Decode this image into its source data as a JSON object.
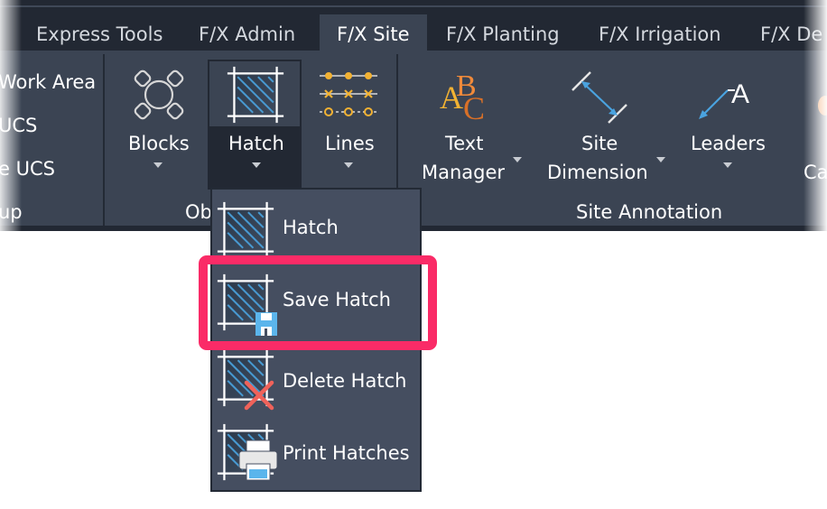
{
  "tabs": [
    {
      "label": "Express Tools",
      "active": false
    },
    {
      "label": "F/X Admin",
      "active": false
    },
    {
      "label": "F/X Site",
      "active": true
    },
    {
      "label": "F/X Planting",
      "active": false
    },
    {
      "label": "F/X Irrigation",
      "active": false
    },
    {
      "label": "F/X De",
      "active": false
    }
  ],
  "left_panel": {
    "items": [
      "Work Area",
      "UCS",
      "e UCS"
    ],
    "group_label": "up"
  },
  "objects_panel": {
    "buttons": [
      {
        "label": "Blocks",
        "icon": "blocks-icon"
      },
      {
        "label": "Hatch",
        "icon": "hatch-icon"
      },
      {
        "label": "Lines",
        "icon": "lines-icon"
      }
    ],
    "group_label": "Ob"
  },
  "site_annotation_panel": {
    "buttons": [
      {
        "label_line1": "Text",
        "label_line2": "Manager",
        "icon": "text-manager-icon"
      },
      {
        "label_line1": "Site",
        "label_line2": "Dimension",
        "icon": "site-dimension-icon"
      },
      {
        "label_line1": "Leaders",
        "label_line2": "",
        "icon": "leaders-icon"
      },
      {
        "label_line1": "",
        "label_line2": "Ca",
        "icon": "callout-icon"
      }
    ],
    "group_label": "Site Annotation"
  },
  "hatch_menu": {
    "items": [
      {
        "label": "Hatch",
        "icon": "hatch-icon",
        "highlighted": false
      },
      {
        "label": "Save Hatch",
        "icon": "save-hatch-icon",
        "highlighted": true
      },
      {
        "label": "Delete Hatch",
        "icon": "delete-hatch-icon",
        "highlighted": false
      },
      {
        "label": "Print Hatches",
        "icon": "print-hatches-icon",
        "highlighted": false
      }
    ]
  },
  "colors": {
    "ribbon_bg": "#3b4453",
    "tabbar_bg": "#222833",
    "menu_bg": "#454e60",
    "highlight": "#fa2b67",
    "hatch_blue": "#4aa3df",
    "lines_gold": "#f2b233"
  }
}
